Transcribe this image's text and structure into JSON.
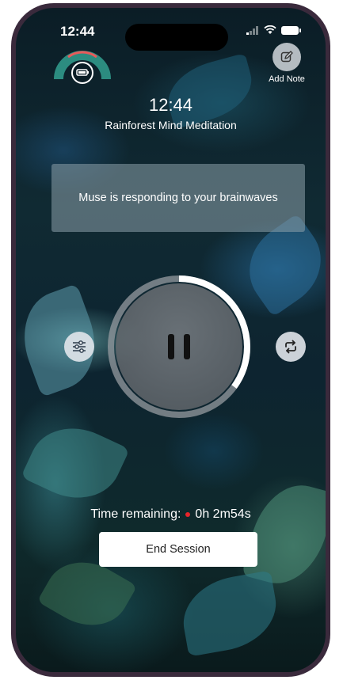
{
  "status_bar": {
    "time": "12:44"
  },
  "header": {
    "add_note_label": "Add Note"
  },
  "session": {
    "clock": "12:44",
    "title": "Rainforest Mind Meditation",
    "feedback_message": "Muse is responding to your brainwaves",
    "progress_fraction": 0.35
  },
  "footer": {
    "time_remaining_label": "Time remaining:",
    "time_remaining_value": "0h 2m54s",
    "end_session_label": "End Session"
  },
  "colors": {
    "accent_teal": "#2c8c80",
    "recording_dot": "#e8242a",
    "headband_arc_red": "#e85a5a"
  },
  "icons": {
    "add_note": "edit-note-icon",
    "settings": "sliders-icon",
    "loop": "repeat-icon",
    "play_pause": "pause-icon"
  }
}
